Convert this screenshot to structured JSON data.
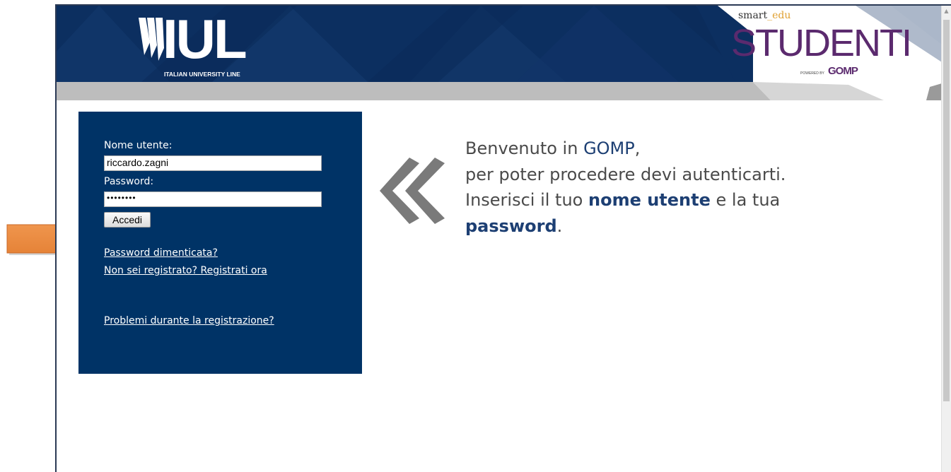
{
  "header": {
    "logo_text": "IUL",
    "logo_subtitle": "ITALIAN UNIVERSITY LINE",
    "brand_prefix": "smart",
    "brand_suffix": "edu",
    "brand_title": "STUDENTI",
    "powered_by": "POWERED BY",
    "gomp_logo": "GOMP"
  },
  "login": {
    "username_label": "Nome utente:",
    "username_value": "riccardo.zagni",
    "password_label": "Password:",
    "password_value": "••••••••",
    "submit_label": "Accedi",
    "forgot_link": "Password dimenticata?",
    "register_link": "Non sei registrato? Registrati ora",
    "problems_link": "Problemi durante la registrazione?"
  },
  "welcome": {
    "line1_prefix": "Benvenuto in ",
    "line1_brand": "GOMP",
    "line1_suffix": ",",
    "line2": "per poter procedere devi autenticarti.",
    "line3_prefix": "Inserisci il tuo ",
    "line3_bold": "nome utente",
    "line3_suffix": " e la tua",
    "line4_bold": "password",
    "line4_suffix": "."
  },
  "colors": {
    "navy": "#003366",
    "banner": "#0c2f60",
    "accent_text": "#1d3f73",
    "arrow": "#ef8a3c",
    "studenti": "#5b2a6e"
  },
  "icons": {
    "chevron": "double-chevron-left-icon",
    "arrow": "orange-arrow-right-icon"
  }
}
